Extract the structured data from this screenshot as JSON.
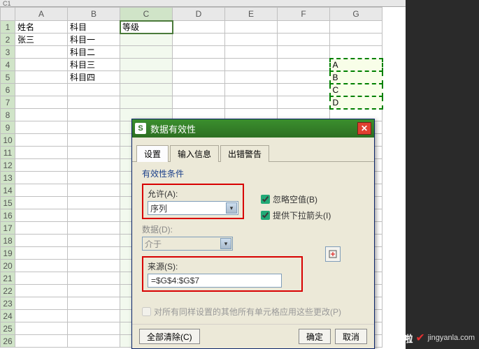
{
  "namebox": "C1",
  "columns": [
    "A",
    "B",
    "C",
    "D",
    "E",
    "F",
    "G"
  ],
  "rows_count": 26,
  "cells": {
    "r1": {
      "A": "姓名",
      "B": "科目",
      "C": "等级"
    },
    "r2": {
      "A": "张三",
      "B": "科目一"
    },
    "r3": {
      "B": "科目二"
    },
    "r4": {
      "B": "科目三",
      "G": "A"
    },
    "r5": {
      "B": "科目四",
      "G": "B"
    },
    "r6": {
      "G": "C"
    },
    "r7": {
      "G": "D"
    }
  },
  "selected_column": "C",
  "active_cell": "C1",
  "marching_range": [
    "G4",
    "G7"
  ],
  "dialog": {
    "title": "数据有效性",
    "tabs": [
      "设置",
      "输入信息",
      "出错警告"
    ],
    "active_tab": 0,
    "section": "有效性条件",
    "allow_label": "允许(A):",
    "allow_value": "序列",
    "data_label": "数据(D):",
    "data_value": "介于",
    "source_label": "来源(S):",
    "source_value": "=$G$4:$G$7",
    "chk_ignore_blank": "忽略空值(B)",
    "chk_dropdown": "提供下拉箭头(I)",
    "apply_all": "对所有同样设置的其他所有单元格应用这些更改(P)",
    "btn_clear": "全部清除(C)",
    "btn_ok": "确定",
    "btn_cancel": "取消"
  },
  "watermark": {
    "brand": "经验啦",
    "url": "jingyanla.com"
  }
}
